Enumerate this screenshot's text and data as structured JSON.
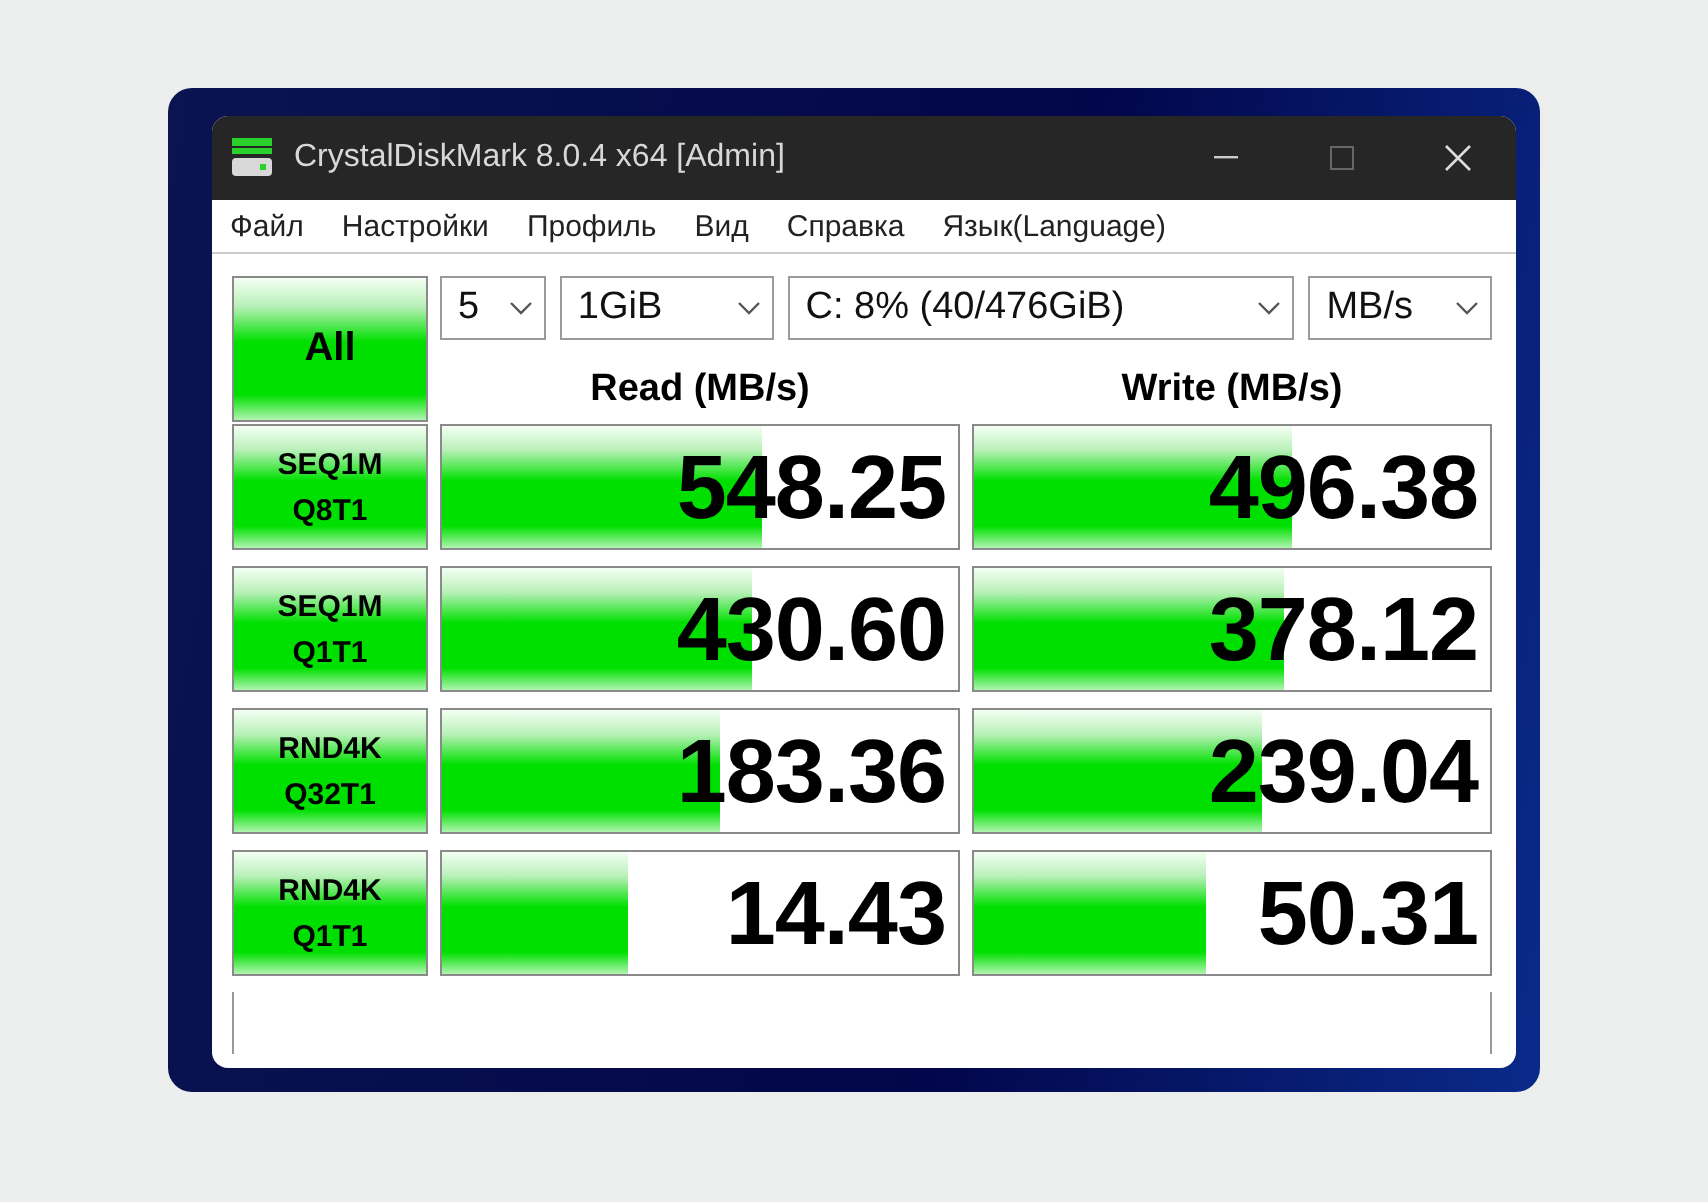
{
  "window": {
    "title": "CrystalDiskMark 8.0.4 x64 [Admin]"
  },
  "menu": [
    "Файл",
    "Настройки",
    "Профиль",
    "Вид",
    "Справка",
    "Язык(Language)"
  ],
  "all_button": "All",
  "selectors": [
    {
      "value": "5"
    },
    {
      "value": "1GiB"
    },
    {
      "value": "C: 8% (40/476GiB)"
    },
    {
      "value": "MB/s"
    }
  ],
  "columns": [
    "Read (MB/s)",
    "Write (MB/s)"
  ],
  "tests": [
    {
      "line1": "SEQ1M",
      "line2": "Q8T1",
      "read": {
        "value": "548.25",
        "level": 0.62
      },
      "write": {
        "value": "496.38",
        "level": 0.615
      }
    },
    {
      "line1": "SEQ1M",
      "line2": "Q1T1",
      "read": {
        "value": "430.60",
        "level": 0.6
      },
      "write": {
        "value": "378.12",
        "level": 0.6
      }
    },
    {
      "line1": "RND4K",
      "line2": "Q32T1",
      "read": {
        "value": "183.36",
        "level": 0.54
      },
      "write": {
        "value": "239.04",
        "level": 0.56
      }
    },
    {
      "line1": "RND4K",
      "line2": "Q1T1",
      "read": {
        "value": "14.43",
        "level": 0.36
      },
      "write": {
        "value": "50.31",
        "level": 0.45
      }
    }
  ]
}
